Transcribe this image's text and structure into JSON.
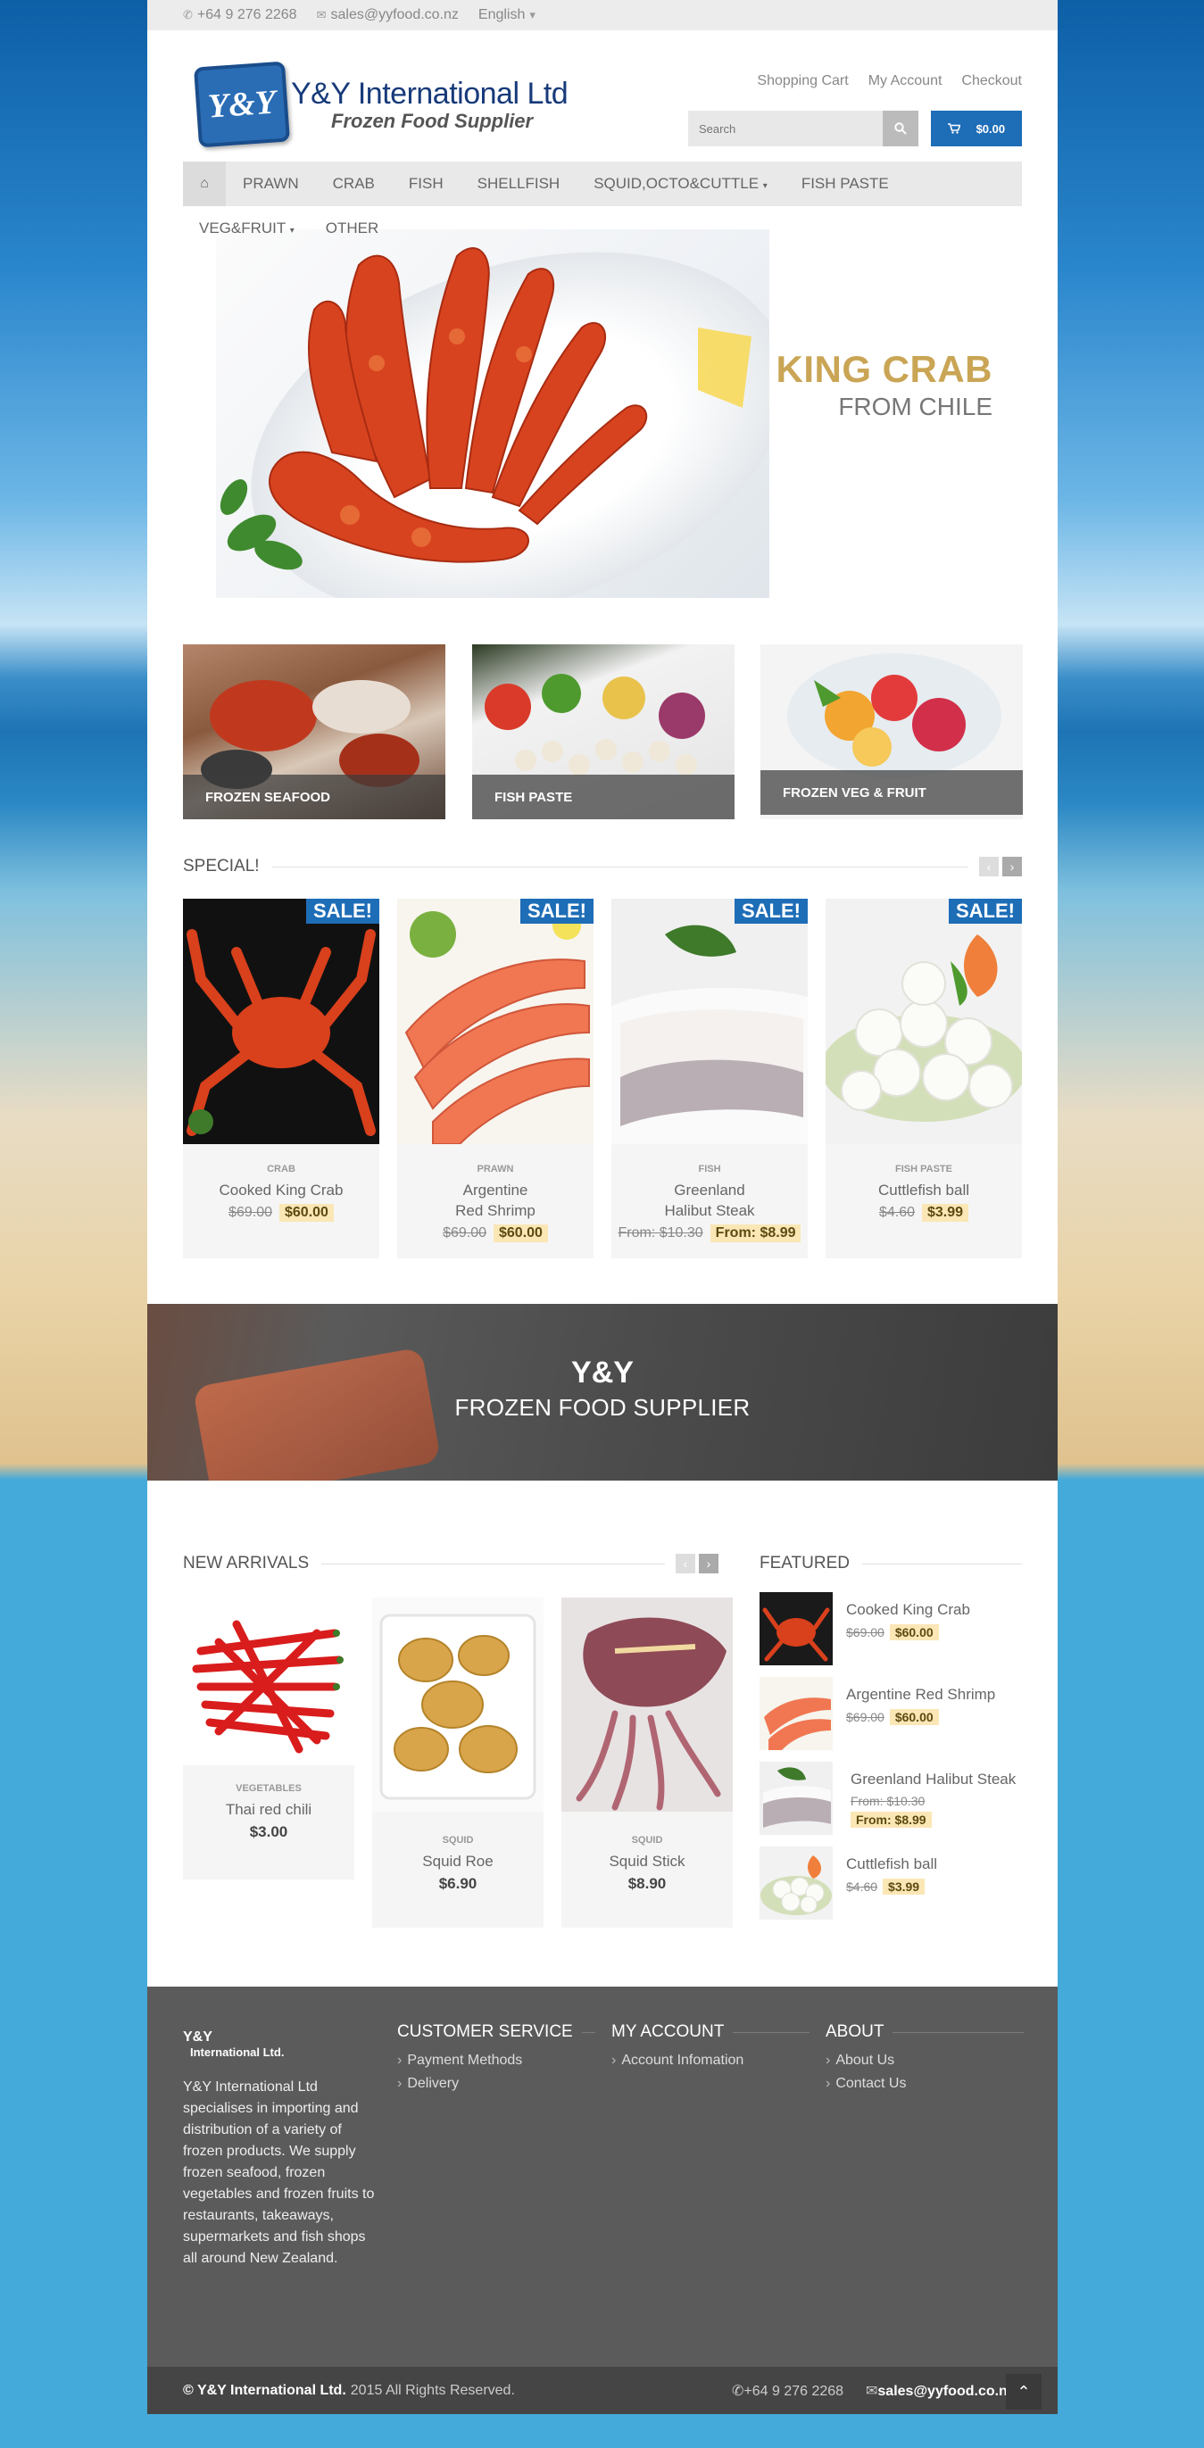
{
  "topbar": {
    "phone": "+64 9 276 2268",
    "email": "sales@yyfood.co.nz",
    "language": "English"
  },
  "logo": {
    "badge": "Y&Y",
    "title": "Y&Y International Ltd",
    "subtitle": "Frozen Food Supplier"
  },
  "header_links": [
    "Shopping Cart",
    "My Account",
    "Checkout"
  ],
  "search": {
    "placeholder": "Search"
  },
  "cart": {
    "total": "$0.00"
  },
  "nav": {
    "items": [
      "PRAWN",
      "CRAB",
      "FISH",
      "SHELLFISH",
      "SQUID,OCTO&CUTTLE",
      "FISH PASTE"
    ],
    "row2": [
      "VEG&FRUIT",
      "OTHER"
    ]
  },
  "hero": {
    "title": "KING CRAB",
    "subtitle": "FROM CHILE"
  },
  "categories": [
    "FROZEN SEAFOOD",
    "FISH PASTE",
    "FROZEN VEG & FRUIT"
  ],
  "special": {
    "heading": "SPECIAL!",
    "sale_badge": "SALE!",
    "products": [
      {
        "category": "CRAB",
        "name": "Cooked King Crab",
        "old_price": "$69.00",
        "new_price": "$60.00"
      },
      {
        "category": "PRAWN",
        "name": "Argentine Red Shrimp",
        "old_price": "$69.00",
        "new_price": "$60.00"
      },
      {
        "category": "FISH",
        "name": "Greenland Halibut Steak",
        "old_price": "From: $10.30",
        "new_price": "From: $8.99"
      },
      {
        "category": "FISH PASTE",
        "name": "Cuttlefish ball",
        "old_price": "$4.60",
        "new_price": "$3.99"
      }
    ]
  },
  "banner": {
    "title": "Y&Y",
    "subtitle": "FROZEN FOOD SUPPLIER"
  },
  "new_arrivals": {
    "heading": "NEW ARRIVALS",
    "products": [
      {
        "category": "VEGETABLES",
        "name": "Thai red chili",
        "price": "$3.00"
      },
      {
        "category": "SQUID",
        "name": "Squid Roe",
        "price": "$6.90"
      },
      {
        "category": "SQUID",
        "name": "Squid Stick",
        "price": "$8.90"
      }
    ]
  },
  "featured": {
    "heading": "FEATURED",
    "items": [
      {
        "name": "Cooked King Crab",
        "old_price": "$69.00",
        "new_price": "$60.00"
      },
      {
        "name": "Argentine Red Shrimp",
        "old_price": "$69.00",
        "new_price": "$60.00"
      },
      {
        "name": "Greenland Halibut Steak",
        "old_price": "From: $10.30",
        "new_price": "From: $8.99"
      },
      {
        "name": "Cuttlefish ball",
        "old_price": "$4.60",
        "new_price": "$3.99"
      }
    ]
  },
  "footer": {
    "logo_line1": "Y&Y",
    "logo_line2": "International Ltd.",
    "about_text": "Y&Y International Ltd specialises in importing and distribution of a variety of frozen products. We supply frozen seafood, frozen vegetables and frozen fruits to restaurants, takeaways, supermarkets and fish shops all around New Zealand.",
    "customer_service": {
      "heading": "CUSTOMER SERVICE",
      "links": [
        "Payment Methods",
        "Delivery"
      ]
    },
    "my_account": {
      "heading": "MY ACCOUNT",
      "links": [
        "Account Infomation"
      ]
    },
    "about": {
      "heading": "ABOUT",
      "links": [
        "About Us",
        "Contact Us"
      ]
    }
  },
  "bottombar": {
    "company": "© Y&Y International Ltd.",
    "rights": "2015 All Rights Reserved.",
    "phone": "+64 9 276 2268",
    "email": "sales@yyfood.co.nz"
  },
  "colors": {
    "accent": "#1e6db7",
    "sale_bg": "#fbe7b5",
    "hero_title": "#c9a555",
    "footer": "#5b5b5b"
  },
  "icons": [
    "phone-icon",
    "mail-icon",
    "home-icon",
    "search-icon",
    "cart-icon",
    "chevron-up-icon"
  ]
}
